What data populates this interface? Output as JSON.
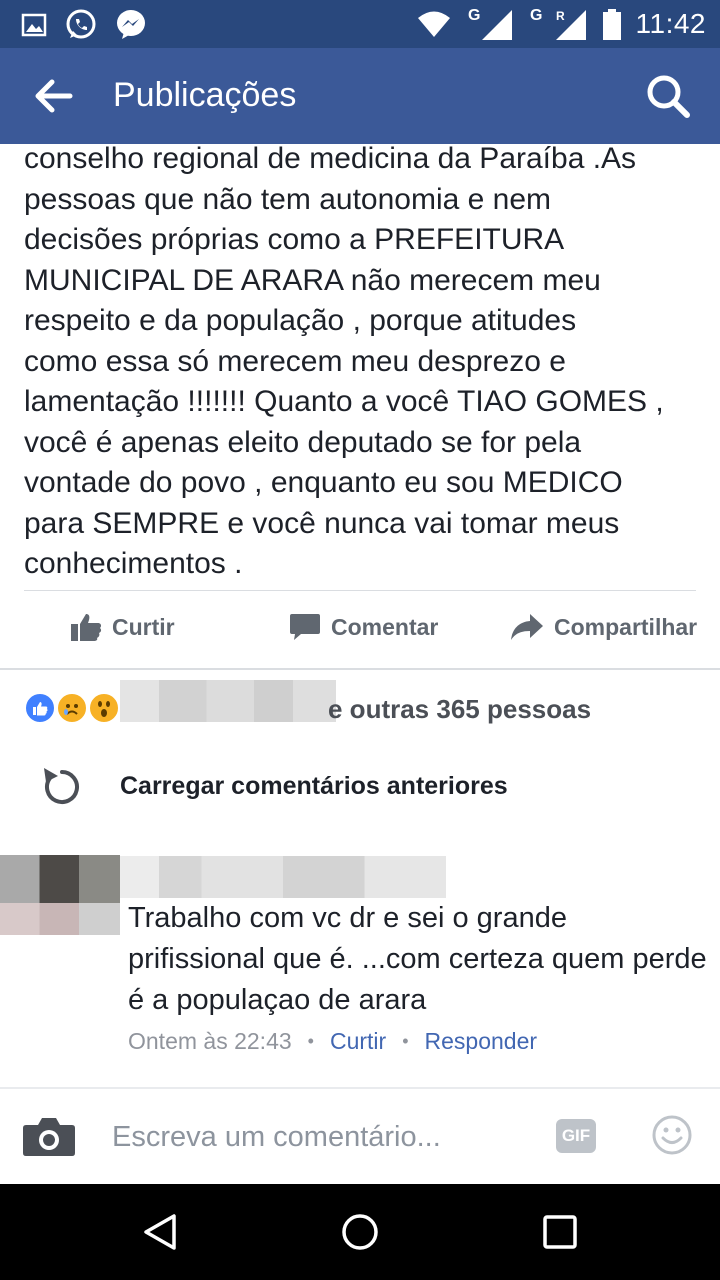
{
  "status_bar": {
    "time": "11:42",
    "network_1": "G",
    "network_2": "G",
    "roaming": "R"
  },
  "app_bar": {
    "title": "Publicações"
  },
  "post": {
    "text": "conselho regional de medicina da Paraíba .As\npessoas  que não tem autonomia e nem\ndecisões próprias como a PREFEITURA\nMUNICIPAL DE ARARA não merecem meu\nrespeito e da população , porque atitudes\ncomo essa só merecem meu desprezo e\nlamentação !!!!!!! Quanto a você TIAO GOMES ,\nvocê é apenas  eleito deputado se for pela\nvontade do povo , enquanto eu sou MEDICO\npara SEMPRE e você nunca vai tomar meus\nconhecimentos ."
  },
  "actions": {
    "like_label": "Curtir",
    "comment_label": "Comentar",
    "share_label": "Compartilhar"
  },
  "reactions": {
    "others_text": "e outras 365 pessoas"
  },
  "load_previous": {
    "label": "Carregar comentários anteriores"
  },
  "comment": {
    "text": "Trabalho com vc dr e sei o grande prifissional que é. ...com certeza quem perde é a populaçao de arara",
    "timestamp": "Ontem às 22:43",
    "like_label": "Curtir",
    "reply_label": "Responder"
  },
  "composer": {
    "placeholder": "Escreva um comentário...",
    "gif_label": "GIF"
  },
  "colors": {
    "brand": "#3b5998",
    "status_bar": "#29487d",
    "link": "#4267b2"
  }
}
